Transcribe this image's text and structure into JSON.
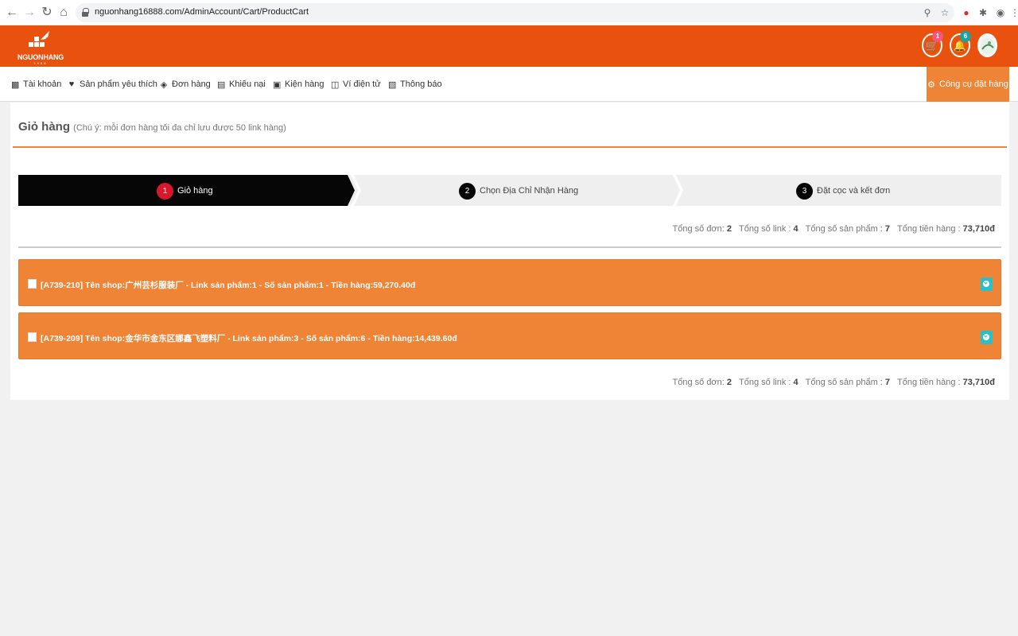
{
  "browser": {
    "url": "nguonhang16888.com/AdminAccount/Cart/ProductCart"
  },
  "header": {
    "logo_text": "NGUONHANG",
    "logo_sub": "1688",
    "cart_count": "1",
    "notify_count": "6",
    "cart_badge_color": "#f05a7e",
    "notify_badge_color": "#1aa3a0"
  },
  "menu": {
    "items": [
      {
        "label": "Tài khoản",
        "icon": "dashboard-icon"
      },
      {
        "label": "Sản phẩm yêu thích",
        "icon": "heart-icon"
      },
      {
        "label": "Đơn hàng",
        "icon": "layers-icon"
      },
      {
        "label": "Khiếu nại",
        "icon": "comment-icon"
      },
      {
        "label": "Kiện hàng",
        "icon": "package-icon"
      },
      {
        "label": "Ví điện tử",
        "icon": "wallet-icon"
      },
      {
        "label": "Thông báo",
        "icon": "notice-icon"
      }
    ],
    "tool_label": "Công cụ đặt hàng"
  },
  "page": {
    "title": "Giỏ hàng",
    "note": "(Chú ý: mỗi đơn hàng tối đa chỉ lưu được 50 link hàng)"
  },
  "steps": [
    {
      "num": "1",
      "label": "Giỏ hàng",
      "active": true
    },
    {
      "num": "2",
      "label": "Chọn Địa Chỉ Nhận Hàng",
      "active": false
    },
    {
      "num": "3",
      "label": "Đặt cọc và kết đơn",
      "active": false
    }
  ],
  "summary": {
    "orders_label": "Tổng số đơn:",
    "orders_value": "2",
    "links_label": "Tổng số link :",
    "links_value": "4",
    "products_label": "Tổng số sản phẩm :",
    "products_value": "7",
    "amount_label": "Tổng tiền hàng :",
    "amount_value": "73,710đ"
  },
  "shops": [
    {
      "text": "[A739-210] Tên shop:广州芸杉服装厂 - Link sản phẩm:1 - Số sản phẩm:1 - Tiền hàng:59,270.40đ"
    },
    {
      "text": "[A739-209] Tên shop:金华市金东区娜鑫飞塑料厂 - Link sản phẩm:3 - Số sản phẩm:6 - Tiền hàng:14,439.60đ"
    }
  ],
  "colors": {
    "brand_orange": "#e9510e",
    "accent_orange": "#ee8436",
    "active_step": "#060606",
    "active_step_num": "#d7182a"
  }
}
